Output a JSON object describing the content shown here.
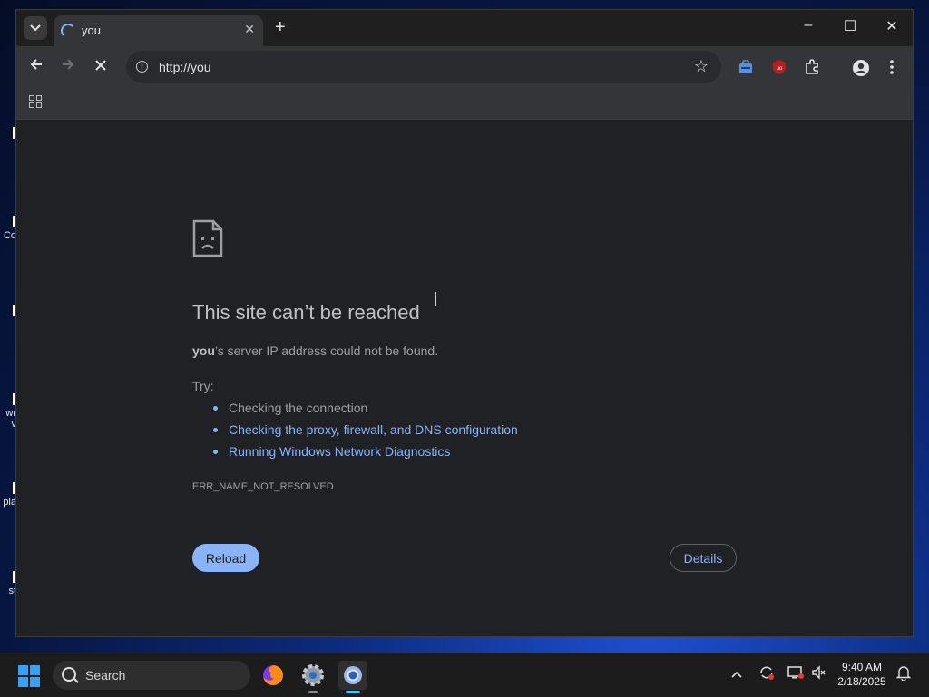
{
  "browser": {
    "tab": {
      "title": "you",
      "close_icon": "close-icon",
      "loading": true
    },
    "new_tab_icon": "plus-icon",
    "window_controls": {
      "minimize": "–",
      "maximize": "☐",
      "close": "✕"
    },
    "address_bar": {
      "url": "http://you"
    },
    "extensions": [
      "toolbox-extension-icon",
      "ublock-extension-icon",
      "puzzle-extensions-icon"
    ],
    "accent_color": "#8ab4f8"
  },
  "error_page": {
    "title": "This site can’t be reached",
    "host": "you",
    "description_suffix": "’s server IP address could not be found.",
    "try_label": "Try:",
    "suggestions": [
      {
        "text": "Checking the connection",
        "is_link": false
      },
      {
        "text": "Checking the proxy, firewall, and DNS configuration",
        "is_link": true
      },
      {
        "text": "Running Windows Network Diagnostics",
        "is_link": true
      }
    ],
    "error_code": "ERR_NAME_NOT_RESOLVED",
    "reload_label": "Reload",
    "details_label": "Details"
  },
  "desktop": {
    "icon_labels": [
      "Co",
      "wr",
      "v",
      "pla",
      "st"
    ]
  },
  "taskbar": {
    "search_label": "Search",
    "apps": [
      "firefox-icon",
      "settings-gear-icon",
      "chrome-icon"
    ],
    "clock": {
      "time": "9:40 AM",
      "date": "2/18/2025"
    }
  }
}
